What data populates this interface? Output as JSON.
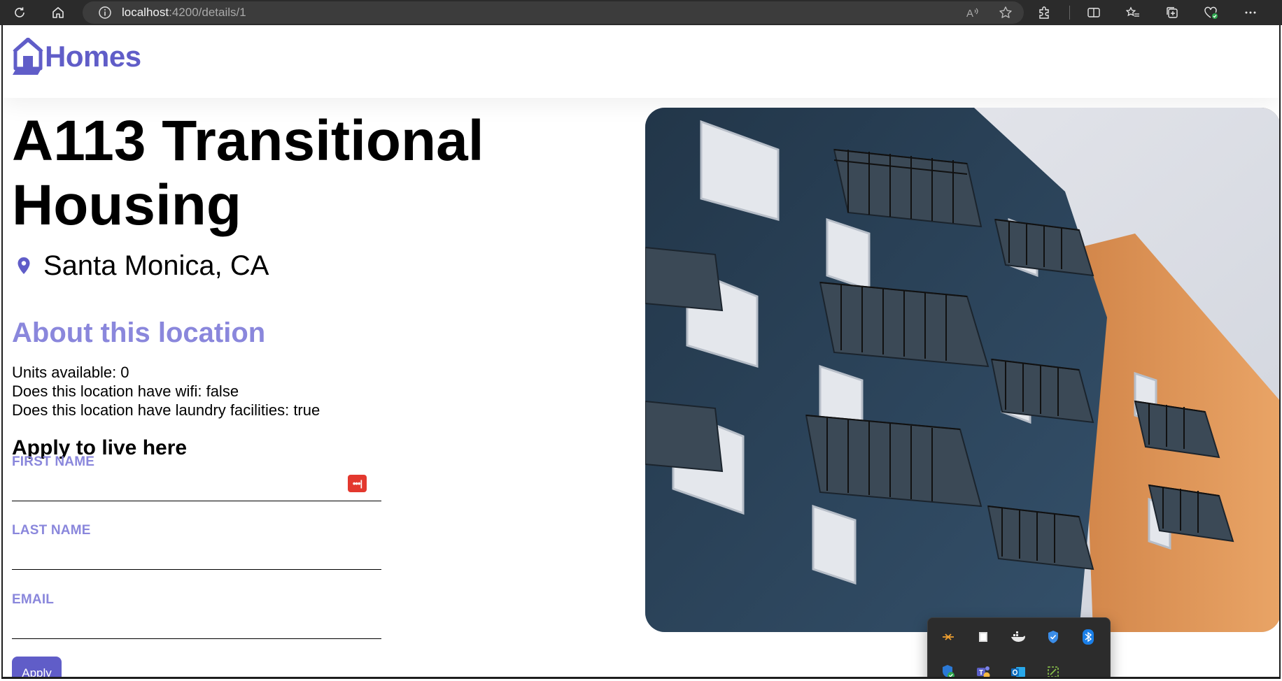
{
  "browser": {
    "url_host": "localhost",
    "url_path": ":4200/details/1"
  },
  "app": {
    "logo_text": "Homes"
  },
  "listing": {
    "name": "A113 Transitional Housing",
    "location": "Santa Monica, CA",
    "about_heading": "About this location",
    "facts": [
      "Units available: 0",
      "Does this location have wifi: false",
      "Does this location have laundry facilities: true"
    ]
  },
  "form": {
    "heading": "Apply to live here",
    "first_name_label": "FIRST NAME",
    "last_name_label": "LAST NAME",
    "email_label": "EMAIL",
    "first_name_value": "",
    "last_name_value": "",
    "email_value": "",
    "submit_label": "Apply",
    "password_manager_badge": "•••|"
  },
  "colors": {
    "brand": "#605dc8",
    "accent_light": "#8a87dc"
  },
  "tray_icons": [
    "remote-desktop-icon",
    "window-icon",
    "docker-icon",
    "defender-icon",
    "bluetooth-icon",
    "security-shield-icon",
    "teams-icon",
    "outlook-icon",
    "snip-icon"
  ]
}
